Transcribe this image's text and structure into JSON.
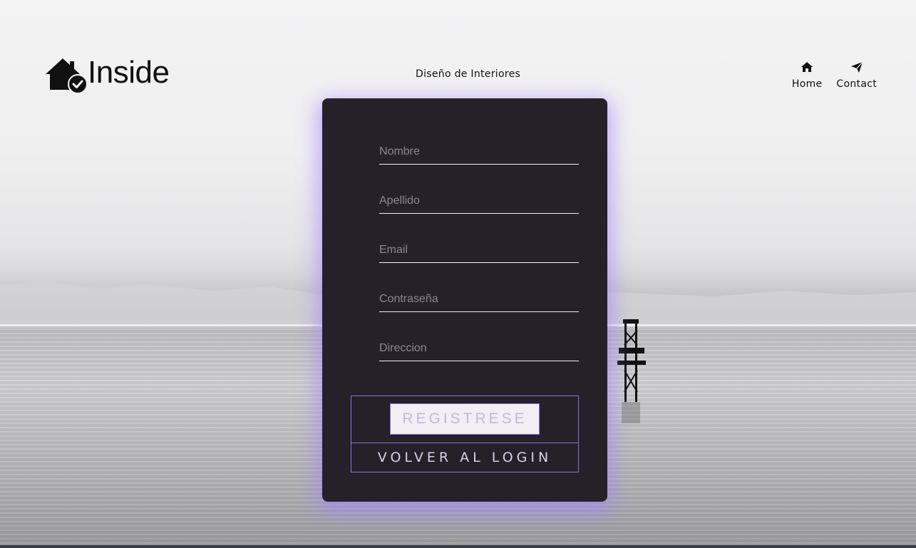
{
  "header": {
    "logo_text": "Inside",
    "tagline": "Diseño de Interiores",
    "nav": [
      {
        "label": "Home",
        "icon": "home-icon"
      },
      {
        "label": "Contact",
        "icon": "paper-plane-icon"
      }
    ]
  },
  "form": {
    "fields": [
      {
        "placeholder": "Nombre",
        "value": ""
      },
      {
        "placeholder": "Apellido",
        "value": ""
      },
      {
        "placeholder": "Email",
        "value": ""
      },
      {
        "placeholder": "Contraseña",
        "value": ""
      },
      {
        "placeholder": "Direccion",
        "value": ""
      }
    ],
    "register_label": "REGISTRESE",
    "back_label": "VOLVER AL LOGIN"
  },
  "colors": {
    "card_background": "#252128",
    "accent": "#8a6fe0",
    "glow": "#a082ff",
    "button_text": "#c6b7df"
  }
}
